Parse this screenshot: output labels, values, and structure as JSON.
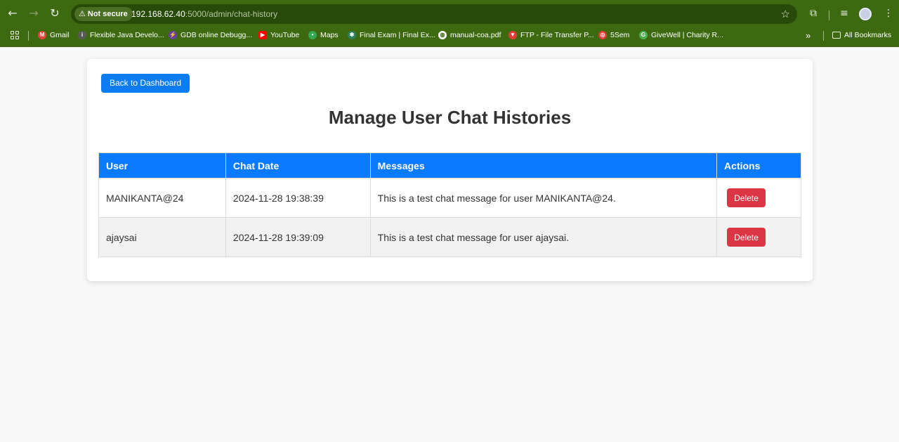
{
  "browser": {
    "security_label": "Not secure",
    "url_host": "192.168.62.40",
    "url_rest": ":5000/admin/chat-history",
    "bookmarks": [
      {
        "label": "Gmail",
        "color": "#ea4335"
      },
      {
        "label": "Flexible Java Develo...",
        "color": "#5a5a5a"
      },
      {
        "label": "GDB online Debugg...",
        "color": "#6b3fa0"
      },
      {
        "label": "YouTube",
        "color": "#ff0000"
      },
      {
        "label": "Maps",
        "color": "#34a853"
      },
      {
        "label": "Final Exam | Final Ex...",
        "color": "#2d7f5e"
      },
      {
        "label": "manual-coa.pdf",
        "color": "#ffffff"
      },
      {
        "label": "FTP - File Transfer P...",
        "color": "#e53935"
      },
      {
        "label": "5Sem",
        "color": "#e53935"
      },
      {
        "label": "GiveWell | Charity R...",
        "color": "#4caf50"
      }
    ],
    "more_label": "»",
    "all_bookmarks": "All Bookmarks"
  },
  "page": {
    "back_button": "Back to Dashboard",
    "title": "Manage User Chat Histories",
    "columns": [
      "User",
      "Chat Date",
      "Messages",
      "Actions"
    ],
    "rows": [
      {
        "user": "MANIKANTA@24",
        "date": "2024-11-28 19:38:39",
        "message": "This is a test chat message for user MANIKANTA@24.",
        "action": "Delete"
      },
      {
        "user": "ajaysai",
        "date": "2024-11-28 19:39:09",
        "message": "This is a test chat message for user ajaysai.",
        "action": "Delete"
      }
    ]
  },
  "colors": {
    "chrome": "#3d6a10",
    "primary": "#0a7bff",
    "danger": "#dc3545"
  }
}
